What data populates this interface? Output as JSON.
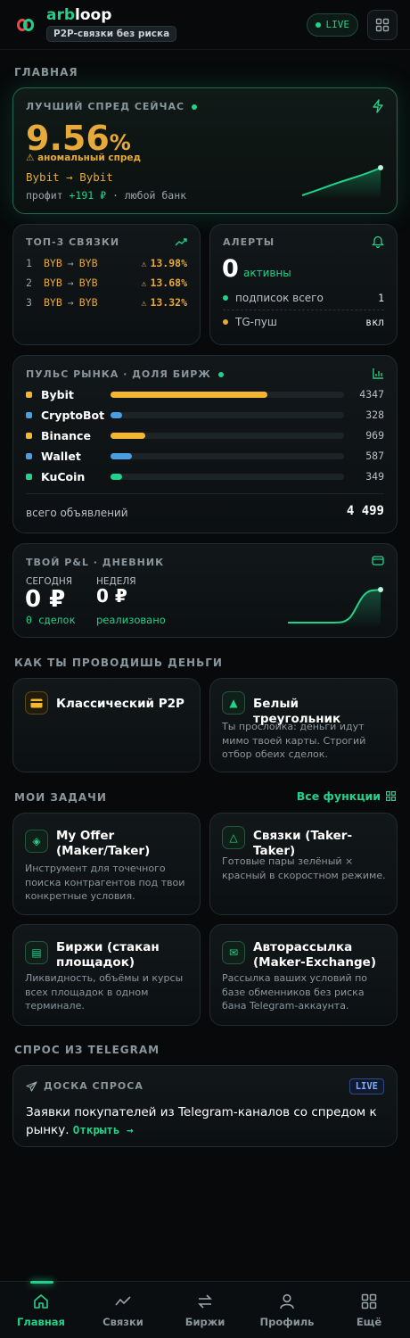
{
  "header": {
    "brand_prefix": "arb",
    "brand_suffix": "loop",
    "tagline": "P2P-связки без риска",
    "live_label": "LIVE"
  },
  "sections": {
    "home": "ГЛАВНАЯ",
    "how_money": "КАК ТЫ ПРОВОДИШЬ ДЕНЬГИ",
    "tasks": "МОИ ЗАДАЧИ",
    "all_functions": "Все функции",
    "demand": "СПРОС ИЗ TELEGRAM"
  },
  "best_spread": {
    "label": "ЛУЧШИЙ СПРЕД СЕЙЧАС",
    "value": "9.56",
    "unit": "%",
    "anomaly": "⚠ аномальный спред",
    "route": "Bybit → Bybit",
    "profit_prefix": "профит",
    "profit_value": "+191 ₽",
    "profit_suffix": "· любой банк"
  },
  "top3": {
    "label": "ТОП-3 СВЯЗКИ",
    "rows": [
      {
        "n": "1",
        "from": "BYB",
        "arrow": "→",
        "to": "BYB",
        "warn": "⚠",
        "value": "13.98%"
      },
      {
        "n": "2",
        "from": "BYB",
        "arrow": "→",
        "to": "BYB",
        "warn": "⚠",
        "value": "13.68%"
      },
      {
        "n": "3",
        "from": "BYB",
        "arrow": "→",
        "to": "BYB",
        "warn": "⚠",
        "value": "13.32%"
      }
    ]
  },
  "alerts": {
    "label": "АЛЕРТЫ",
    "count": "0",
    "count_label": "активны",
    "rows": [
      {
        "label": "подписок всего",
        "value": "1",
        "color": "#22d18b"
      },
      {
        "label": "TG-пуш",
        "value": "вкл",
        "color": "#e6a93a"
      }
    ]
  },
  "pulse": {
    "label": "ПУЛЬС РЫНКА · ДОЛЯ БИРЖ",
    "rows": [
      {
        "name": "Bybit",
        "value": "4347",
        "share": 0.67,
        "color": "#f5b731"
      },
      {
        "name": "CryptoBot",
        "value": "328",
        "share": 0.05,
        "color": "#4a9fe0"
      },
      {
        "name": "Binance",
        "value": "969",
        "share": 0.15,
        "color": "#f5b731"
      },
      {
        "name": "Wallet",
        "value": "587",
        "share": 0.09,
        "color": "#4a9fe0"
      },
      {
        "name": "KuCoin",
        "value": "349",
        "share": 0.05,
        "color": "#22d18b"
      }
    ],
    "total_label": "всего объявлений",
    "total_value": "4 499"
  },
  "pnl": {
    "label": "ТВОЙ P&L · ДНЕВНИК",
    "today_label": "СЕГОДНЯ",
    "today_value": "0 ₽",
    "today_sub": "0 сделок",
    "week_label": "НЕДЕЛЯ",
    "week_value": "0 ₽",
    "week_sub": "реализовано"
  },
  "money_methods": [
    {
      "title": "Классический P2P",
      "desc": ""
    },
    {
      "title": "Белый треугольник",
      "desc": "Ты прослойка: деньги идут мимо твоей карты. Строгий отбор обеих сделок."
    }
  ],
  "tasks": [
    {
      "title": "My Offer (Maker/Taker)",
      "desc": "Инструмент для точечного поиска контрагентов под твои конкретные условия."
    },
    {
      "title": "Связки (Taker-Taker)",
      "desc": "Готовые пары зелёный × красный в скоростном режиме."
    },
    {
      "title": "Биржи (стакан площадок)",
      "desc": "Ликвидность, объёмы и курсы всех площадок в одном терминале."
    },
    {
      "title": "Авторассылка (Maker-Exchange)",
      "desc": "Рассылка ваших условий по базе обменников без риска бана Telegram-аккаунта."
    }
  ],
  "demand_board": {
    "label": "ДОСКА СПРОСА",
    "live": "LIVE",
    "text": "Заявки покупателей из Telegram-каналов со спредом к рынку.",
    "link": "Открыть →"
  },
  "nav": [
    {
      "label": "Главная",
      "icon": "home-icon",
      "active": true
    },
    {
      "label": "Связки",
      "icon": "chart-line-icon",
      "active": false
    },
    {
      "label": "Биржи",
      "icon": "exchange-icon",
      "active": false
    },
    {
      "label": "Профиль",
      "icon": "user-icon",
      "active": false
    },
    {
      "label": "Ещё",
      "icon": "grid-icon",
      "active": false
    }
  ]
}
